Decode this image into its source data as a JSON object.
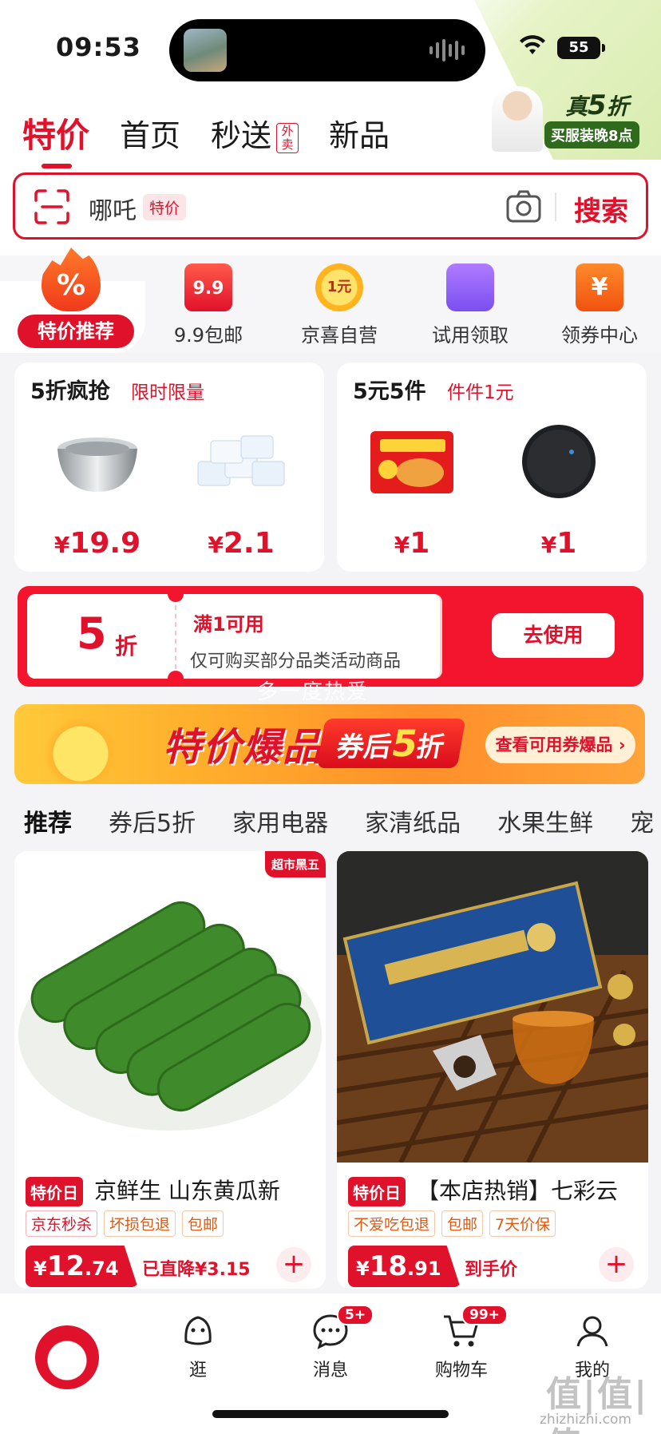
{
  "status": {
    "time": "09:53",
    "battery": "55"
  },
  "tabs": [
    {
      "label": "特价"
    },
    {
      "label": "首页"
    },
    {
      "label": "秒送",
      "badge": "外卖"
    },
    {
      "label": "新品"
    }
  ],
  "ad": {
    "title_prefix": "真",
    "title_num": "5",
    "title_suffix": "折",
    "subtitle": "买服装晚8点"
  },
  "search": {
    "placeholder": "哪吒",
    "tag": "特价",
    "button": "搜索"
  },
  "categories": [
    {
      "label": "特价推荐",
      "icon": "fire-icon",
      "badge": "%"
    },
    {
      "label": "9.9包邮",
      "icon": "bag-icon",
      "badge": "9.9"
    },
    {
      "label": "京喜自营",
      "icon": "medal-icon",
      "badge": "1元"
    },
    {
      "label": "试用领取",
      "icon": "gift-bag-icon"
    },
    {
      "label": "领券中心",
      "icon": "coupon-icon",
      "badge": "¥"
    }
  ],
  "promo_left": {
    "title": "5折疯抢",
    "subtitle": "限时限量",
    "items": [
      {
        "price": "19.9",
        "icon": "steel-bowl-icon"
      },
      {
        "price": "2.1",
        "icon": "tissue-pack-icon"
      }
    ]
  },
  "promo_right": {
    "title": "5元5件",
    "subtitle": "件件1元",
    "items": [
      {
        "price": "1",
        "icon": "instant-noodle-icon"
      },
      {
        "price": "1",
        "icon": "round-mat-icon"
      }
    ]
  },
  "currency": "¥",
  "coupon": {
    "amount": "5",
    "unit": "折",
    "condition": "满1可用",
    "desc": "仅可购买部分品类活动商品",
    "button": "去使用"
  },
  "watermark_mid": "多一度热爱",
  "banner": {
    "title": "特价爆品",
    "after_prefix": "券后",
    "after_num": "5",
    "after_suffix": "折",
    "button": "查看可用券爆品 ›"
  },
  "feed_tabs": [
    "推荐",
    "券后5折",
    "家用电器",
    "家清纸品",
    "水果生鲜",
    "宠"
  ],
  "products": [
    {
      "badge": "超市黑五",
      "day": "特价日",
      "title": "京鲜生 山东黄瓜新",
      "tags": [
        "京东秒杀",
        "坏损包退",
        "包邮"
      ],
      "price_int": "12",
      "price_dec": ".74",
      "note": "已直降¥3.15"
    },
    {
      "badge": "",
      "day": "特价日",
      "title": "【本店热销】七彩云",
      "tags": [
        "不爱吃包退",
        "包邮",
        "7天价保"
      ],
      "price_int": "18",
      "price_dec": ".91",
      "note": "到手价"
    }
  ],
  "bottom_nav": [
    {
      "label": "",
      "icon": "home-mascot-icon"
    },
    {
      "label": "逛",
      "icon": "stroll-icon"
    },
    {
      "label": "消息",
      "icon": "message-icon",
      "badge": "5+"
    },
    {
      "label": "购物车",
      "icon": "cart-icon",
      "badge": "99+"
    },
    {
      "label": "我的",
      "icon": "profile-icon"
    }
  ],
  "watermark": {
    "logo": "值|值|值",
    "url": "zhizhizhi.com"
  },
  "colors": {
    "accent": "#e0112b",
    "banner": "#ff9a2a",
    "ad_green": "#2f6a1d"
  }
}
